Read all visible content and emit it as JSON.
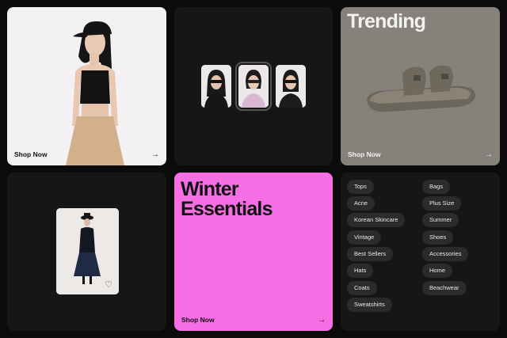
{
  "tile_fashion": {
    "cta": "Shop Now",
    "arrow": "→"
  },
  "tile_trending": {
    "title": "Trending",
    "cta": "Shop Now",
    "arrow": "→"
  },
  "tile_winter": {
    "title_line1": "Winter",
    "title_line2": "Essentials",
    "cta": "Shop Now",
    "arrow": "→"
  },
  "tile_product": {
    "heart_icon": "♡"
  },
  "categories": {
    "left": [
      "Tops",
      "Acne",
      "Korean Skincare",
      "Vintage",
      "Best Sellers",
      "Hats",
      "Coats",
      "Sweatshirts"
    ],
    "right": [
      "Bags",
      "Plus Size",
      "Summer",
      "Shoes",
      "Accessories",
      "Home",
      "Beachwear"
    ]
  },
  "colors": {
    "background": "#0b0b0b",
    "trending_bg": "#87817b",
    "winter_bg": "#f66ee4",
    "chip_bg": "#2b2b2b"
  }
}
